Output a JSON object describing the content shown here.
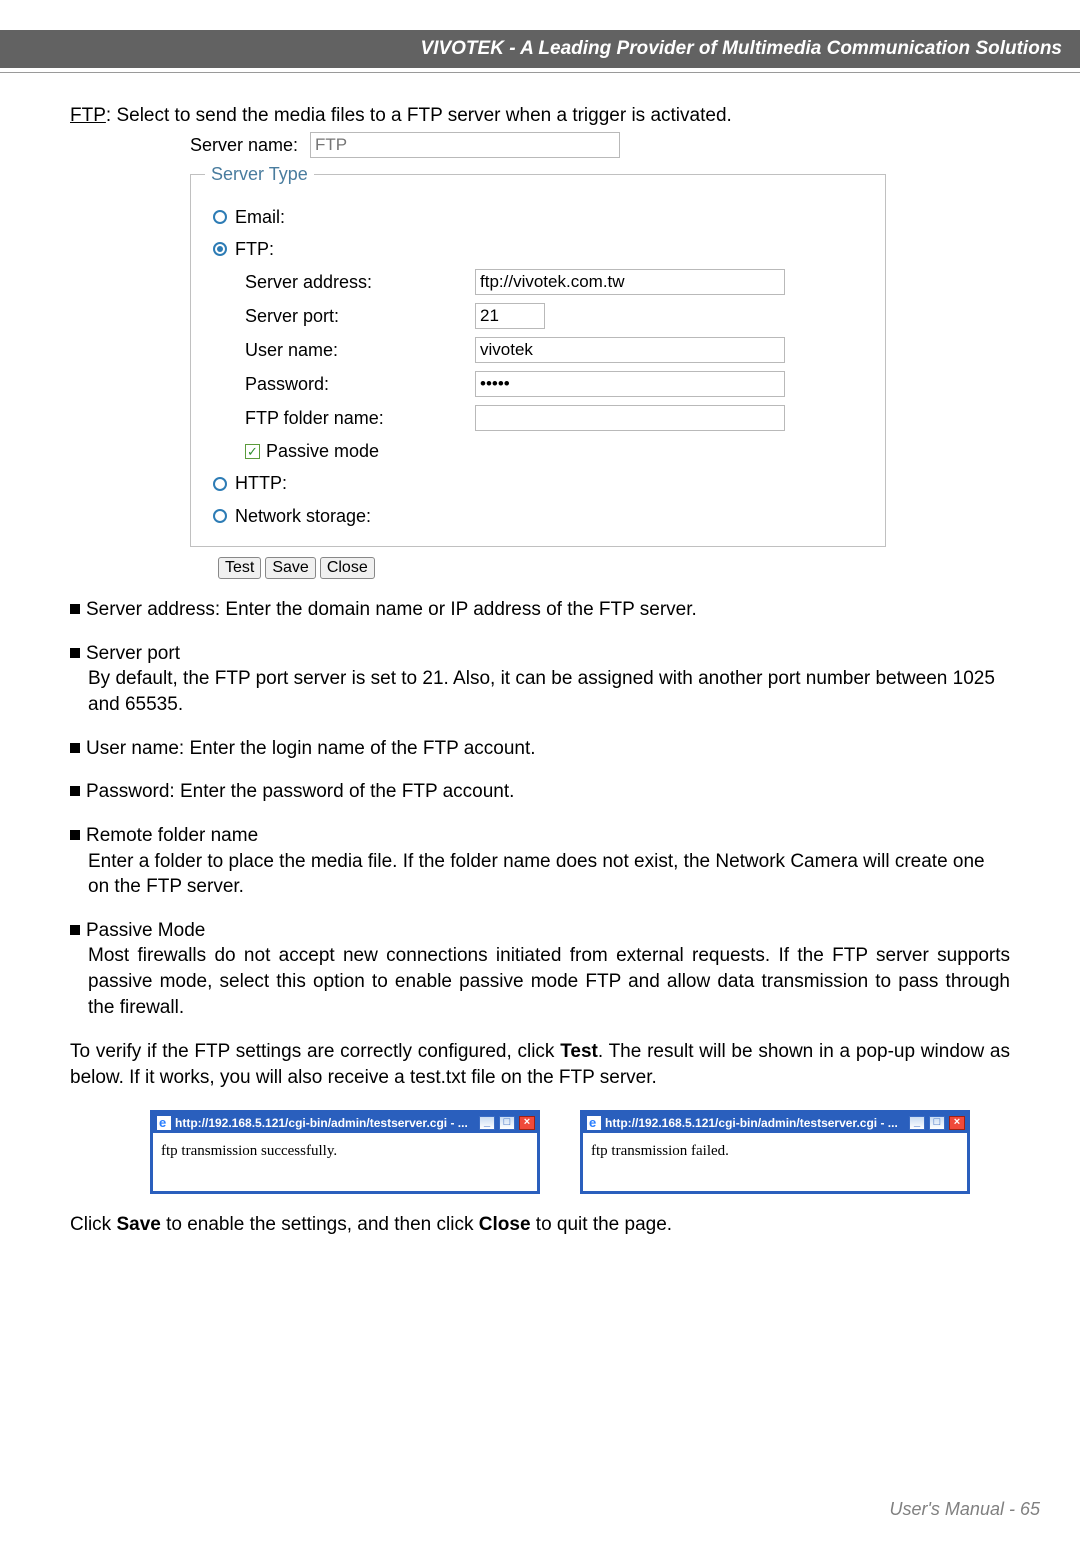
{
  "header": {
    "title": "VIVOTEK - A Leading Provider of Multimedia Communication Solutions"
  },
  "intro": {
    "term": "FTP",
    "text": ": Select to send the media files to a FTP server when a trigger is activated."
  },
  "config": {
    "server_name_label": "Server name:",
    "server_name_placeholder": "FTP",
    "fieldset_legend": "Server Type",
    "radios": {
      "email": "Email:",
      "ftp": "FTP:",
      "http": "HTTP:",
      "network_storage": "Network storage:"
    },
    "ftp": {
      "server_address_label": "Server address:",
      "server_address_value": "ftp://vivotek.com.tw",
      "server_port_label": "Server port:",
      "server_port_value": "21",
      "user_name_label": "User name:",
      "user_name_value": "vivotek",
      "password_label": "Password:",
      "password_display": "•••••",
      "ftp_folder_label": "FTP folder name:",
      "ftp_folder_value": "",
      "passive_mode_label": "Passive mode"
    }
  },
  "buttons": {
    "test": "Test",
    "save": "Save",
    "close": "Close"
  },
  "bullets": {
    "server_address": "Server address: Enter the domain name or IP address of the FTP server.",
    "server_port_head": "Server port",
    "server_port_body": "By default, the FTP port server is set to 21. Also, it can be assigned with another port  number between 1025 and 65535.",
    "user_name": "User name: Enter the login name of the FTP account.",
    "password": "Password: Enter the password of the FTP account.",
    "remote_folder_head": "Remote folder name",
    "remote_folder_body": "Enter a folder to place the media file. If the folder name does not exist, the Network Camera will create one on the FTP server.",
    "passive_head": "Passive Mode",
    "passive_body": "Most firewalls do not accept new connections initiated from external requests. If the FTP server supports passive mode, select this option to enable passive mode FTP and allow data transmission to pass through the firewall."
  },
  "verify": {
    "pre": "To verify if the FTP settings are correctly configured, click ",
    "test_bold": "Test",
    "post": ". The result will be shown in a pop-up window as below. If it works, you will also receive a test.txt file on the FTP server."
  },
  "popup": {
    "title": "http://192.168.5.121/cgi-bin/admin/testserver.cgi - ...",
    "success": "ftp transmission successfully.",
    "failed": "ftp transmission failed."
  },
  "closing": {
    "pre": "Click ",
    "save_bold": "Save",
    "mid": " to enable the settings,  and then click ",
    "close_bold": "Close",
    "post": " to quit the page."
  },
  "footer": {
    "label": "User's Manual - ",
    "page": "65"
  }
}
